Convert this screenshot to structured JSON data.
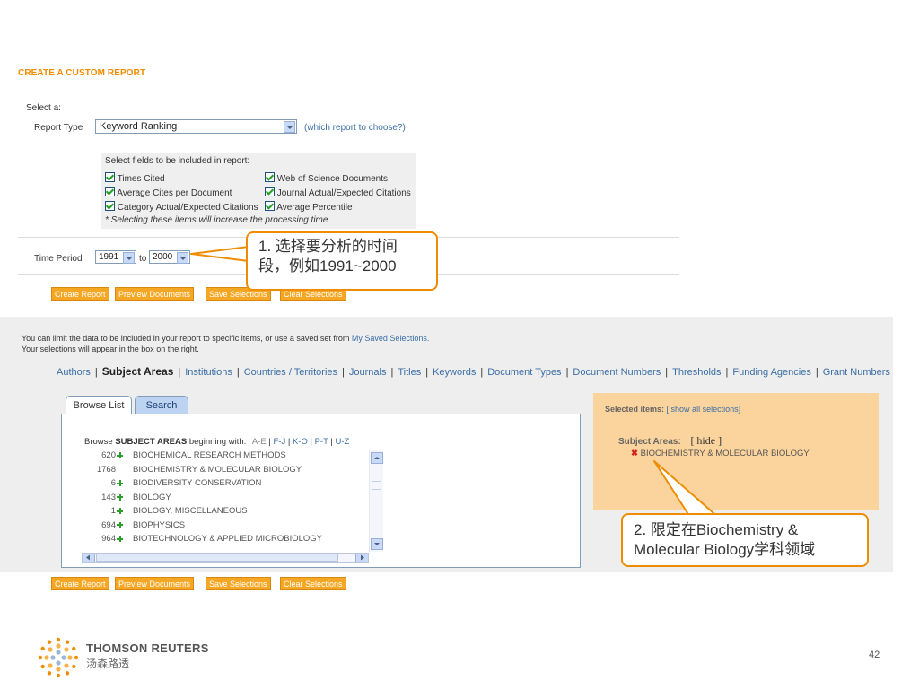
{
  "report": {
    "title": "CREATE A CUSTOM REPORT",
    "select_a": "Select a:",
    "report_type_label": "Report Type",
    "report_type_value": "Keyword Ranking",
    "which_report": "(which report to choose?)",
    "fields_heading": "Select fields to be included in report:",
    "fields": [
      "Times Cited",
      "Web of Science Documents",
      "Average Cites per Document",
      "Journal Actual/Expected Citations",
      "Category Actual/Expected Citations",
      "Average Percentile"
    ],
    "fields_note": "* Selecting these items will increase the processing time",
    "time_period_label": "Time Period",
    "time_from": "1991",
    "time_to_label": "to",
    "time_to": "2000"
  },
  "buttons": {
    "create": "Create Report",
    "preview": "Preview Documents",
    "save": "Save Selections",
    "clear": "Clear Selections"
  },
  "limit": {
    "line1_prefix": "You can limit the data to be included in your report to specific items, or use a saved set from ",
    "line1_link": "My Saved Selections.",
    "line2": "Your selections will appear in the box on the right."
  },
  "nav": [
    "Authors",
    "Subject Areas",
    "Institutions",
    "Countries / Territories",
    "Journals",
    "Titles",
    "Keywords",
    "Document Types",
    "Document Numbers",
    "Thresholds",
    "Funding Agencies",
    "Grant Numbers"
  ],
  "tabs": {
    "browse": "Browse List",
    "search": "Search"
  },
  "browse": {
    "prefix": "Browse ",
    "bold": "SUBJECT AREAS",
    "suffix": " beginning with:",
    "ranges": [
      "A-E",
      "F-J",
      "K-O",
      "P-T",
      "U-Z"
    ]
  },
  "subjects": [
    {
      "count": "620",
      "plus": true,
      "name": "BIOCHEMICAL RESEARCH METHODS"
    },
    {
      "count": "1768",
      "plus": false,
      "name": "BIOCHEMISTRY & MOLECULAR BIOLOGY"
    },
    {
      "count": "6",
      "plus": true,
      "name": "BIODIVERSITY CONSERVATION"
    },
    {
      "count": "143",
      "plus": true,
      "name": "BIOLOGY"
    },
    {
      "count": "1",
      "plus": true,
      "name": "BIOLOGY, MISCELLANEOUS"
    },
    {
      "count": "694",
      "plus": true,
      "name": "BIOPHYSICS"
    },
    {
      "count": "964",
      "plus": true,
      "name": "BIOTECHNOLOGY & APPLIED MICROBIOLOGY"
    }
  ],
  "selected": {
    "heading": "Selected items:",
    "show_all": "[ show all selections]",
    "subject_label": "Subject Areas:",
    "hide": "[ hide ]",
    "item": "BIOCHEMISTRY & MOLECULAR BIOLOGY"
  },
  "callouts": {
    "one_line1": "1. 选择要分析的时间",
    "one_line2": "段，例如1991~2000",
    "two_line1": "2. 限定在Biochemistry &",
    "two_line2": "Molecular Biology学科领域"
  },
  "footer": {
    "brand": "THOMSON REUTERS",
    "brand_cn": "汤森路透",
    "page": "42"
  },
  "colors": {
    "accent": "#f08c00",
    "button": "#f5a623",
    "selected_bg": "#fbd39c",
    "link": "#3a6ea5"
  }
}
